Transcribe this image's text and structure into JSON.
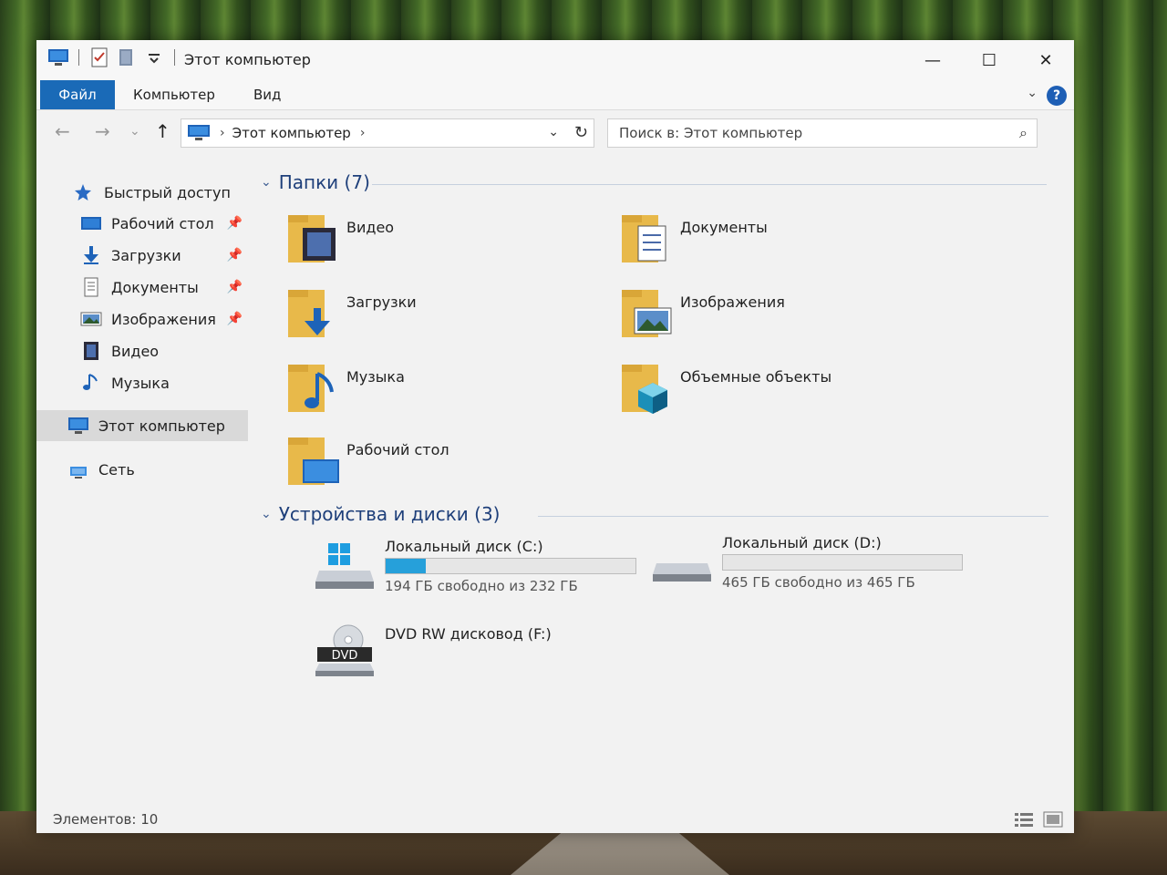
{
  "window": {
    "title": "Этот компьютер",
    "controls": {
      "minimize": "—",
      "maximize": "☐",
      "close": "✕"
    }
  },
  "ribbon": {
    "tabs": [
      "Файл",
      "Компьютер",
      "Вид"
    ],
    "help": "?"
  },
  "navigation": {
    "back": "←",
    "forward": "→",
    "recent": "⌄",
    "up": "↑",
    "address_crumb": "Этот компьютер",
    "search_placeholder": "Поиск в: Этот компьютер"
  },
  "sidebar": {
    "quick_access": "Быстрый доступ",
    "items": [
      {
        "label": "Рабочий стол",
        "icon": "desktop-icon",
        "pinned": true
      },
      {
        "label": "Загрузки",
        "icon": "downloads-icon",
        "pinned": true
      },
      {
        "label": "Документы",
        "icon": "documents-icon",
        "pinned": true
      },
      {
        "label": "Изображения",
        "icon": "pictures-icon",
        "pinned": true
      },
      {
        "label": "Видео",
        "icon": "video-icon",
        "pinned": false
      },
      {
        "label": "Музыка",
        "icon": "music-icon",
        "pinned": false
      }
    ],
    "this_pc": "Этот компьютер",
    "network": "Сеть"
  },
  "content": {
    "folders_header": "Папки (7)",
    "folders": [
      {
        "name": "Видео",
        "icon": "video-folder-icon"
      },
      {
        "name": "Документы",
        "icon": "documents-folder-icon"
      },
      {
        "name": "Загрузки",
        "icon": "downloads-folder-icon"
      },
      {
        "name": "Изображения",
        "icon": "pictures-folder-icon"
      },
      {
        "name": "Музыка",
        "icon": "music-folder-icon"
      },
      {
        "name": "Объемные объекты",
        "icon": "3d-objects-folder-icon"
      },
      {
        "name": "Рабочий стол",
        "icon": "desktop-folder-icon"
      }
    ],
    "devices_header": "Устройства и диски (3)",
    "drives": [
      {
        "name": "Локальный диск (C:)",
        "free": "194 ГБ свободно из 232 ГБ",
        "used_fraction": 0.16,
        "icon": "windows-drive-icon"
      },
      {
        "name": "Локальный диск (D:)",
        "free": "465 ГБ свободно из 465 ГБ",
        "used_fraction": 0.0,
        "icon": "hard-drive-icon"
      },
      {
        "name": "DVD RW дисковод (F:)",
        "icon": "dvd-drive-icon",
        "label_on_icon": "DVD"
      }
    ]
  },
  "status": {
    "items_count": "Элементов: 10"
  },
  "colors": {
    "accent": "#1a6ab7",
    "progress": "#26a0da",
    "folder": "#e8b94a",
    "header_text": "#1e3f7a"
  }
}
